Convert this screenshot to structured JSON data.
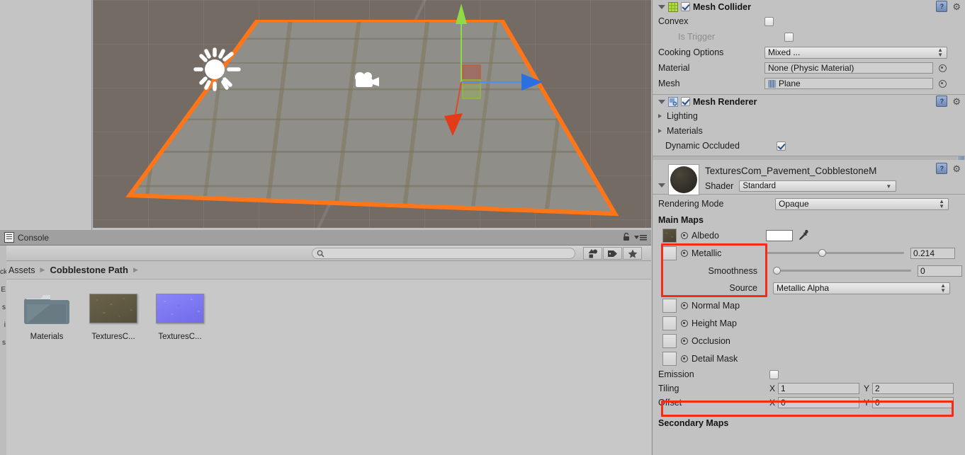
{
  "scene": {
    "name": "scene-view",
    "gizmo_axes": [
      "y-green-up",
      "x-blue-right",
      "z-red-down"
    ],
    "selection_outline_color": "#ff7518",
    "background_color": "#736b64",
    "light_icon": "directional-light-icon",
    "camera_icon": "camera-icon"
  },
  "console_tab": {
    "label": "Console",
    "icon": "console-icon",
    "lock_icon": "lock-icon",
    "menu_icon": "hamburger-menu-icon"
  },
  "project": {
    "search": {
      "value": "",
      "placeholder": "",
      "icon": "search-icon"
    },
    "toolbar_buttons": [
      {
        "name": "filter-by-type-button",
        "icon": "shapes-icon"
      },
      {
        "name": "filter-by-label-button",
        "icon": "label-tag-icon"
      },
      {
        "name": "favorites-button",
        "icon": "star-icon"
      }
    ],
    "breadcrumb": [
      "Assets",
      "Cobblestone Path"
    ],
    "assets": [
      {
        "label": "Materials",
        "type": "folder"
      },
      {
        "label": "TexturesC...",
        "type": "texture-albedo"
      },
      {
        "label": "TexturesC...",
        "type": "texture-normal"
      }
    ],
    "left_sliver_text": [
      "",
      "ck",
      "E",
      "s",
      "i",
      "s"
    ]
  },
  "inspector": {
    "mesh_collider": {
      "title": "Mesh Collider",
      "enabled": true,
      "icon": "mesh-collider-icon",
      "help_icon": "help-icon",
      "gear_icon": "gear-icon",
      "rows": [
        {
          "label": "Convex",
          "type": "checkbox",
          "checked": false,
          "dim": false
        },
        {
          "label": "Is Trigger",
          "type": "checkbox",
          "checked": false,
          "dim": true
        },
        {
          "label": "Cooking Options",
          "type": "popup",
          "value": "Mixed ..."
        },
        {
          "label": "Material",
          "type": "object",
          "value": "None (Physic Material)",
          "icon": ""
        },
        {
          "label": "Mesh",
          "type": "object",
          "value": "Plane",
          "icon": "mesh-icon"
        }
      ]
    },
    "mesh_renderer": {
      "title": "Mesh Renderer",
      "enabled": true,
      "icon": "mesh-renderer-icon",
      "help_icon": "help-icon",
      "gear_icon": "gear-icon",
      "foldouts": [
        "Lighting",
        "Materials"
      ],
      "dynamic_occluded": {
        "label": "Dynamic Occluded",
        "checked": true
      }
    },
    "material": {
      "name": "TexturesCom_Pavement_CobblestoneM",
      "preview": "material-sphere-preview",
      "help_icon": "help-icon",
      "gear_icon": "gear-icon",
      "shader_label": "Shader",
      "shader_value": "Standard",
      "rendering_mode_label": "Rendering Mode",
      "rendering_mode_value": "Opaque",
      "main_maps_header": "Main Maps",
      "albedo": {
        "label": "Albedo",
        "color": "#ffffff",
        "eyedropper": "eyedropper-icon",
        "has_texture": true
      },
      "metallic": {
        "label": "Metallic",
        "value": "0.214",
        "slider_pct": 21.4
      },
      "smoothness": {
        "label": "Smoothness",
        "value": "0",
        "slider_pct": 0
      },
      "source": {
        "label": "Source",
        "value": "Metallic Alpha"
      },
      "map_slots": [
        {
          "label": "Normal Map"
        },
        {
          "label": "Height Map"
        },
        {
          "label": "Occlusion"
        },
        {
          "label": "Detail Mask"
        }
      ],
      "emission": {
        "label": "Emission",
        "checked": false
      },
      "tiling": {
        "label": "Tiling",
        "x_label": "X",
        "x": "1",
        "y_label": "Y",
        "y": "2"
      },
      "offset": {
        "label": "Offset",
        "x_label": "X",
        "x": "0",
        "y_label": "Y",
        "y": "0"
      },
      "secondary_maps_header": "Secondary Maps"
    },
    "highlight_color": "#f22c16"
  }
}
